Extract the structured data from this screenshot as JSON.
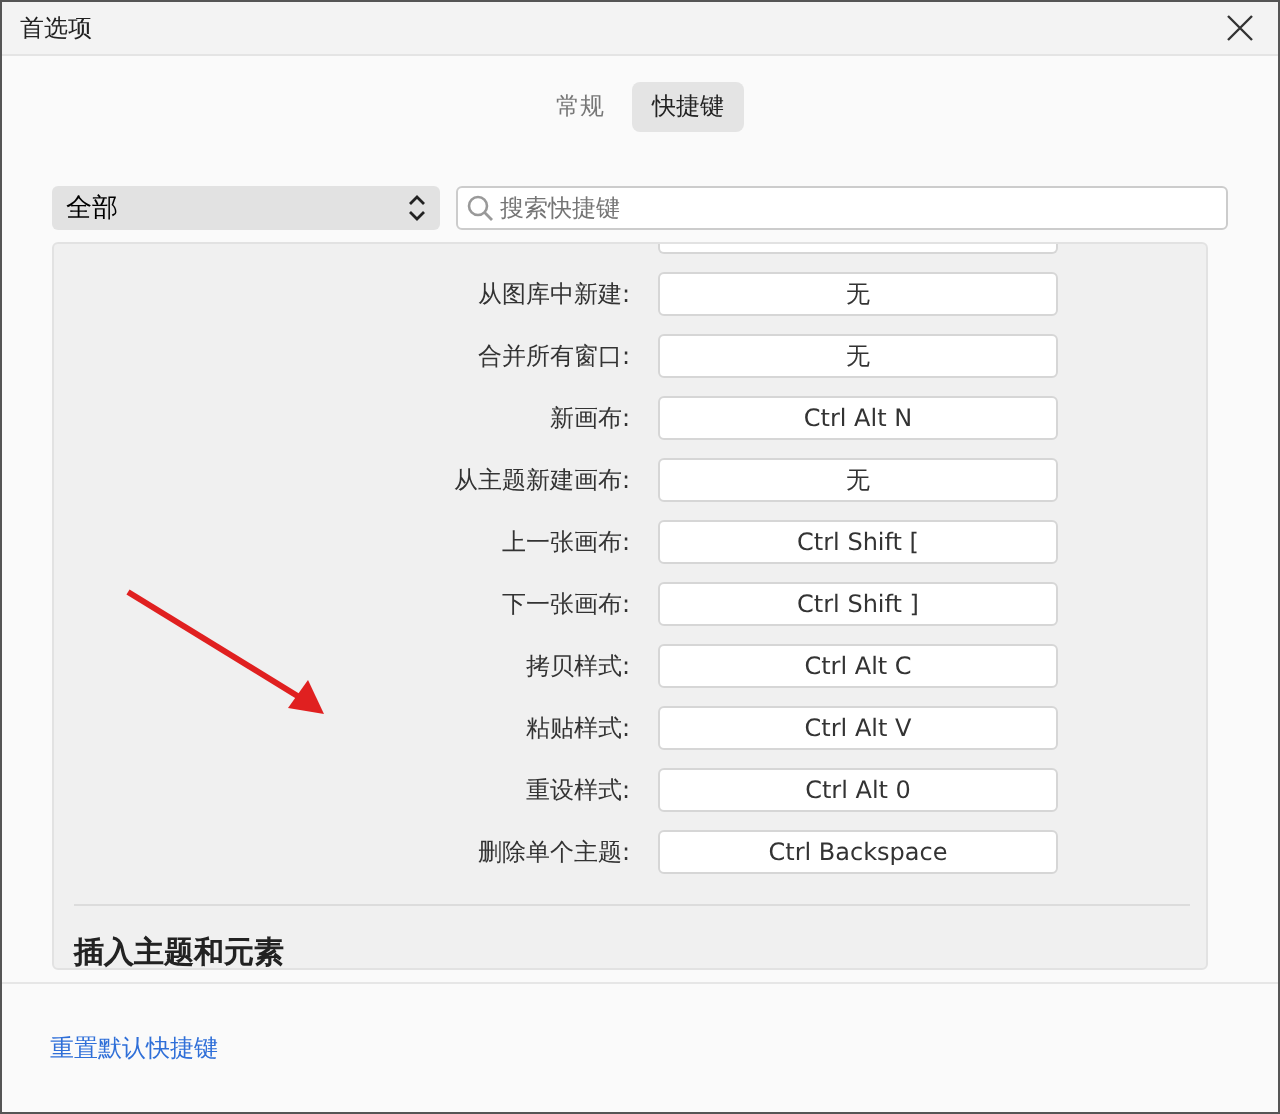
{
  "window": {
    "title": "首选项"
  },
  "tabs": [
    {
      "label": "常规",
      "selected": false
    },
    {
      "label": "快捷键",
      "selected": true
    }
  ],
  "filter": {
    "value": "全部"
  },
  "search": {
    "placeholder": "搜索快捷键"
  },
  "shortcuts": [
    {
      "label": "从图库中新建:",
      "key": "无"
    },
    {
      "label": "合并所有窗口:",
      "key": "无"
    },
    {
      "label": "新画布:",
      "key": "Ctrl Alt N"
    },
    {
      "label": "从主题新建画布:",
      "key": "无"
    },
    {
      "label": "上一张画布:",
      "key": "Ctrl Shift ["
    },
    {
      "label": "下一张画布:",
      "key": "Ctrl Shift ]"
    },
    {
      "label": "拷贝样式:",
      "key": "Ctrl Alt C"
    },
    {
      "label": "粘贴样式:",
      "key": "Ctrl Alt V"
    },
    {
      "label": "重设样式:",
      "key": "Ctrl Alt 0"
    },
    {
      "label": "删除单个主题:",
      "key": "Ctrl Backspace"
    }
  ],
  "next_section": "插入主题和元素",
  "footer": {
    "reset_link": "重置默认快捷键"
  }
}
